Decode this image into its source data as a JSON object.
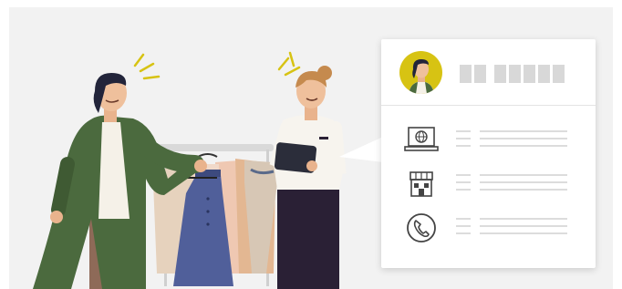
{
  "scene": {
    "description_icons": [
      "laptop-globe-icon",
      "storefront-icon",
      "phone-icon"
    ]
  },
  "colors": {
    "background": "#f2f2f2",
    "customer_coat": "#4b6a3e",
    "dress": "#505f9a",
    "avatar_bg": "#d7c313",
    "staff_pants": "#2a2035",
    "placeholder": "#d8d8d8"
  },
  "card": {
    "contact_rows": [
      {
        "icon": "laptop-globe-icon"
      },
      {
        "icon": "storefront-icon"
      },
      {
        "icon": "phone-icon"
      }
    ]
  }
}
